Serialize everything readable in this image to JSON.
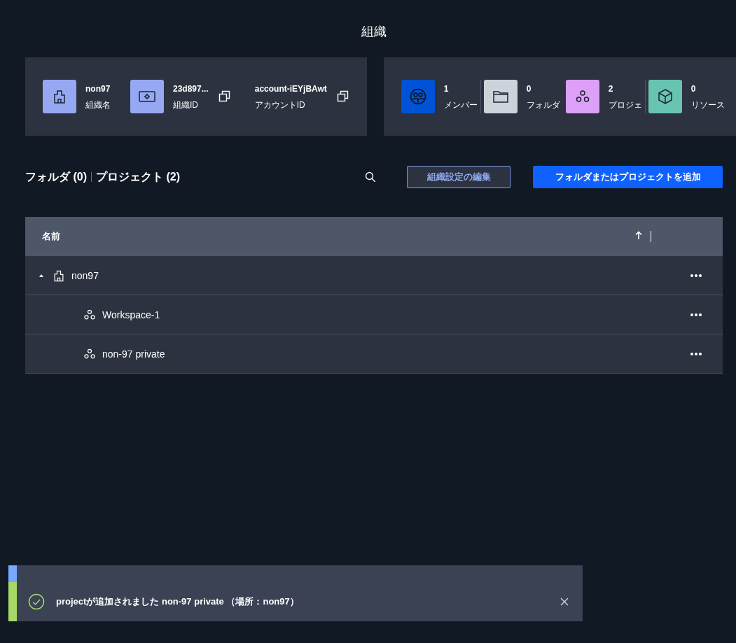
{
  "page": {
    "title": "組織"
  },
  "org_card": {
    "items": [
      {
        "kind": "org",
        "value": "non97",
        "label": "組織名",
        "copyable": false
      },
      {
        "kind": "id",
        "value": "23d897...",
        "label": "組織ID",
        "copyable": true
      },
      {
        "kind": "account",
        "value": "account-iEYjBAwt",
        "label": "アカウントID",
        "copyable": true
      }
    ]
  },
  "counts_card": {
    "items": [
      {
        "kind": "members",
        "value": "1",
        "label": "メンバー",
        "color": "#0053d6"
      },
      {
        "kind": "folders",
        "value": "0",
        "label": "フォルダ",
        "color": "#cdd3da"
      },
      {
        "kind": "projects",
        "value": "2",
        "label": "プロジェ",
        "color": "#dda0f8"
      },
      {
        "kind": "resources",
        "value": "0",
        "label": "リソース",
        "color": "#67c4b1"
      }
    ]
  },
  "toolbar": {
    "headings": [
      "フォルダ (0)",
      "プロジェクト (2)"
    ],
    "buttons": [
      {
        "kind": "secondary",
        "label": "組織設定の編集"
      },
      {
        "kind": "primary",
        "label": "フォルダまたはプロジェクトを追加"
      }
    ]
  },
  "table": {
    "columns": [
      {
        "label": "名前",
        "sorted": true
      }
    ],
    "rows": [
      {
        "kind": "org",
        "name": "non97",
        "expanded": true,
        "children": [
          {
            "kind": "project",
            "name": "Workspace-1"
          },
          {
            "kind": "project",
            "name": "non-97 private"
          }
        ]
      }
    ]
  },
  "toasts": [
    {
      "kind": "info"
    },
    {
      "kind": "success",
      "text": "projectが追加されました **non-97 private** （場所：non97）"
    }
  ]
}
